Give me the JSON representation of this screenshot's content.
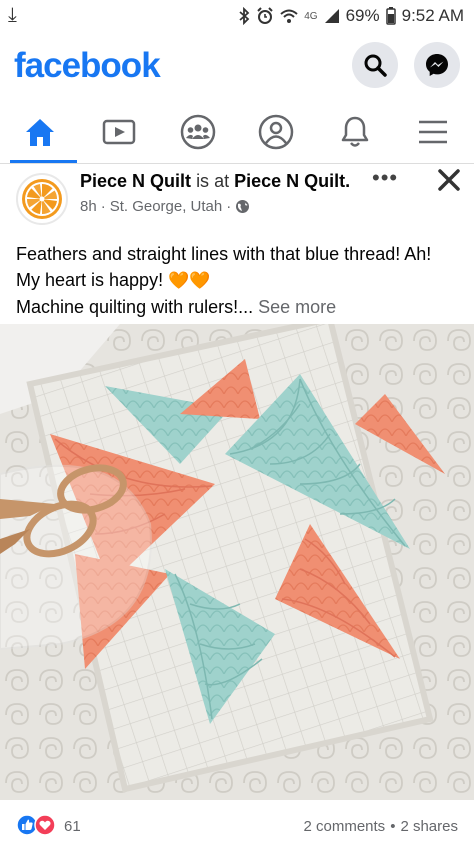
{
  "status_bar": {
    "download_glyph": "⤓",
    "network": "4G",
    "battery": "69%",
    "time": "9:52 AM",
    "icons": [
      "bluetooth-icon",
      "alarm-icon",
      "wifi-icon",
      "signal-icon",
      "battery-icon"
    ]
  },
  "header": {
    "logo": "facebook",
    "brand_color": "#1877f2",
    "actions": [
      "search-icon",
      "messenger-icon"
    ]
  },
  "nav": {
    "items": [
      "home-icon",
      "watch-icon",
      "groups-icon",
      "profile-icon",
      "notifications-icon",
      "menu-icon"
    ],
    "active": "home-icon"
  },
  "post": {
    "author": "Piece N Quilt",
    "connector": "is at",
    "location_page": "Piece N Quilt.",
    "time": "8h",
    "dot": "·",
    "place": "St. George, Utah",
    "audience_icon": "globe-icon",
    "more_label": "•••",
    "text_line1": "Feathers and straight lines with that blue thread! Ah!",
    "text_line2": "My heart is happy!",
    "text_line2_emoji": "🧡🧡",
    "text_line3": "Machine quilting with rulers!...",
    "see_more": "See more",
    "image_subject": "quilt-photo",
    "reactions": [
      "like-icon",
      "love-icon"
    ],
    "reaction_count": "61",
    "comments": "2 comments",
    "shares": "2 shares",
    "stats_dot": "•"
  }
}
